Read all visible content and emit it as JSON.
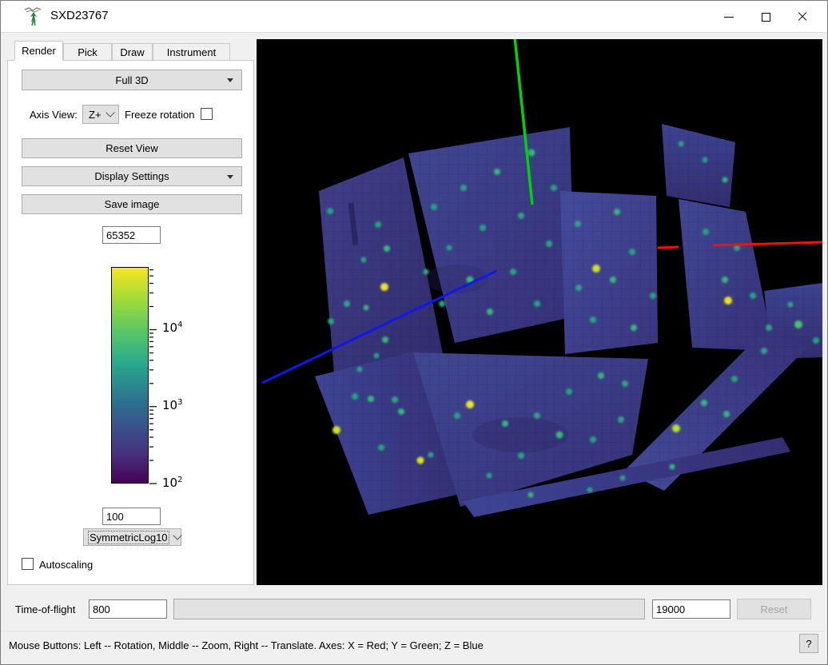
{
  "window": {
    "title": "SXD23767"
  },
  "tabs": [
    {
      "label": "Render",
      "active": true
    },
    {
      "label": "Pick",
      "active": false
    },
    {
      "label": "Draw",
      "active": false
    },
    {
      "label": "Instrument",
      "active": false
    }
  ],
  "render_tab": {
    "projection_button": "Full 3D",
    "axis_view_label": "Axis View:",
    "axis_view_value": "Z+",
    "freeze_rotation_label": "Freeze rotation",
    "freeze_rotation_checked": false,
    "reset_view_button": "Reset View",
    "display_settings_button": "Display Settings",
    "save_image_button": "Save image",
    "scale_max": "65352",
    "scale_min": "100",
    "scale_type": "SymmetricLog10",
    "autoscaling_label": "Autoscaling",
    "autoscaling_checked": false,
    "colorbar": {
      "tick_labels": [
        {
          "base": "10",
          "exp": "4"
        },
        {
          "base": "10",
          "exp": "3"
        },
        {
          "base": "10",
          "exp": "2"
        }
      ],
      "gradient_colors": [
        "#f8e621",
        "#5ec962",
        "#21918c",
        "#3b528b",
        "#440154"
      ]
    }
  },
  "tof": {
    "label": "Time-of-flight",
    "min_value": "800",
    "max_value": "19000",
    "reset_label": "Reset",
    "reset_enabled": false
  },
  "status_bar": {
    "message": "Mouse Buttons: Left -- Rotation, Middle -- Zoom, Right -- Translate. Axes: X = Red; Y = Green; Z = Blue",
    "help_label": "?"
  },
  "scene": {
    "background": "#000000",
    "axis_colors": {
      "x": "#ee1111",
      "y": "#00d400",
      "z": "#1414ee"
    }
  }
}
